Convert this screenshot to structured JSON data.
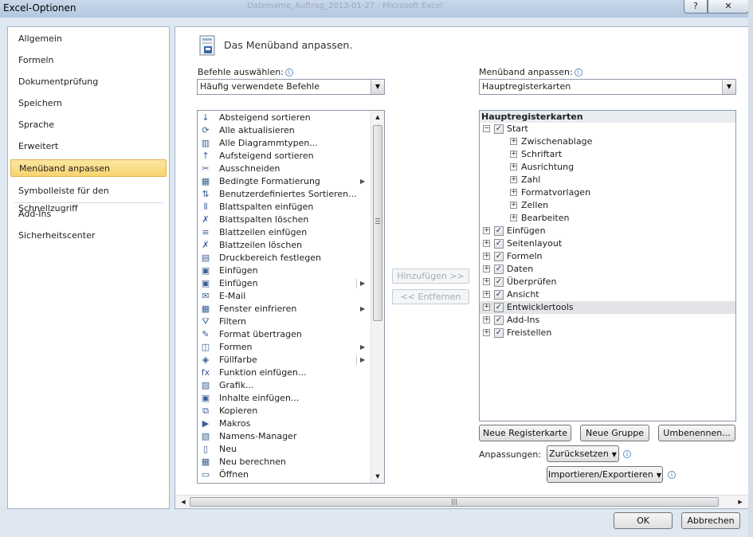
{
  "window": {
    "title": "Excel-Optionen",
    "background_title": "Dateiname_Auftrag_2013-01-27 - Microsoft Excel",
    "help_glyph": "?",
    "close_glyph": "✕"
  },
  "nav": {
    "items": [
      {
        "label": "Allgemein"
      },
      {
        "label": "Formeln"
      },
      {
        "label": "Dokumentprüfung"
      },
      {
        "label": "Speichern"
      },
      {
        "label": "Sprache"
      },
      {
        "label": "Erweitert"
      },
      {
        "label": "Menüband anpassen",
        "selected": true
      },
      {
        "label": "Symbolleiste für den Schnellzugriff"
      },
      {
        "label": "Add-Ins"
      },
      {
        "label": "Sicherheitscenter"
      }
    ]
  },
  "main": {
    "heading": "Das Menüband anpassen.",
    "commands_label": "Befehle auswählen:",
    "commands_combo": "Häufig verwendete Befehle",
    "ribbon_label": "Menüband anpassen:",
    "ribbon_combo": "Hauptregisterkarten",
    "info_glyph": "i",
    "add_button": "Hinzufügen >>",
    "remove_button": "<< Entfernen",
    "commands": [
      {
        "label": "Absteigend sortieren",
        "icon": "sort-descending-icon",
        "glyph": "↓"
      },
      {
        "label": "Alle aktualisieren",
        "icon": "refresh-all-icon",
        "glyph": "⟳"
      },
      {
        "label": "Alle Diagrammtypen...",
        "icon": "chart-types-icon",
        "glyph": "▥"
      },
      {
        "label": "Aufsteigend sortieren",
        "icon": "sort-ascending-icon",
        "glyph": "↑"
      },
      {
        "label": "Ausschneiden",
        "icon": "scissors-icon",
        "glyph": "✂"
      },
      {
        "label": "Bedingte Formatierung",
        "icon": "conditional-format-icon",
        "glyph": "▦",
        "submenu": true
      },
      {
        "label": "Benutzerdefiniertes Sortieren...",
        "icon": "custom-sort-icon",
        "glyph": "⇅"
      },
      {
        "label": "Blattspalten einfügen",
        "icon": "insert-columns-icon",
        "glyph": "⫴"
      },
      {
        "label": "Blattspalten löschen",
        "icon": "delete-columns-icon",
        "glyph": "✗"
      },
      {
        "label": "Blattzeilen einfügen",
        "icon": "insert-rows-icon",
        "glyph": "≡"
      },
      {
        "label": "Blattzeilen löschen",
        "icon": "delete-rows-icon",
        "glyph": "✗"
      },
      {
        "label": "Druckbereich festlegen",
        "icon": "print-area-icon",
        "glyph": "▤"
      },
      {
        "label": "Einfügen",
        "icon": "paste-icon",
        "glyph": "▣"
      },
      {
        "label": "Einfügen",
        "icon": "paste-options-icon",
        "glyph": "▣",
        "split": true
      },
      {
        "label": "E-Mail",
        "icon": "email-icon",
        "glyph": "✉"
      },
      {
        "label": "Fenster einfrieren",
        "icon": "freeze-panes-icon",
        "glyph": "▦",
        "submenu": true
      },
      {
        "label": "Filtern",
        "icon": "filter-icon",
        "glyph": "⛛"
      },
      {
        "label": "Format übertragen",
        "icon": "format-painter-icon",
        "glyph": "✎"
      },
      {
        "label": "Formen",
        "icon": "shapes-icon",
        "glyph": "◫",
        "submenu": true
      },
      {
        "label": "Füllfarbe",
        "icon": "fill-color-icon",
        "glyph": "◈",
        "split": true
      },
      {
        "label": "Funktion einfügen...",
        "icon": "function-icon",
        "glyph": "fx"
      },
      {
        "label": "Grafik...",
        "icon": "picture-icon",
        "glyph": "▨"
      },
      {
        "label": "Inhalte einfügen...",
        "icon": "paste-special-icon",
        "glyph": "▣"
      },
      {
        "label": "Kopieren",
        "icon": "copy-icon",
        "glyph": "⧉"
      },
      {
        "label": "Makros",
        "icon": "macros-icon",
        "glyph": "▶"
      },
      {
        "label": "Namens-Manager",
        "icon": "name-manager-icon",
        "glyph": "▧"
      },
      {
        "label": "Neu",
        "icon": "new-document-icon",
        "glyph": "▯"
      },
      {
        "label": "Neu berechnen",
        "icon": "calculate-icon",
        "glyph": "▦"
      },
      {
        "label": "Öffnen",
        "icon": "open-folder-icon",
        "glyph": "▭"
      }
    ],
    "tree": {
      "header": "Hauptregisterkarten",
      "start": {
        "label": "Start",
        "collapse_glyph": "−",
        "check_glyph": "✓"
      },
      "groups": [
        {
          "label": "Zwischenablage"
        },
        {
          "label": "Schriftart"
        },
        {
          "label": "Ausrichtung"
        },
        {
          "label": "Zahl"
        },
        {
          "label": "Formatvorlagen"
        },
        {
          "label": "Zellen"
        },
        {
          "label": "Bearbeiten"
        }
      ],
      "tabs": [
        {
          "label": "Einfügen"
        },
        {
          "label": "Seitenlayout"
        },
        {
          "label": "Formeln"
        },
        {
          "label": "Daten"
        },
        {
          "label": "Überprüfen"
        },
        {
          "label": "Ansicht"
        },
        {
          "label": "Entwicklertools",
          "highlighted": true
        },
        {
          "label": "Add-Ins"
        },
        {
          "label": "Freistellen"
        }
      ],
      "expand_glyph": "+"
    },
    "new_tab_button": "Neue Registerkarte",
    "new_group_button": "Neue Gruppe",
    "rename_button": "Umbenennen...",
    "customizations_label": "Anpassungen:",
    "reset_button": "Zurücksetzen",
    "import_export_button": "Importieren/Exportieren"
  },
  "footer": {
    "ok": "OK",
    "cancel": "Abbrechen"
  }
}
